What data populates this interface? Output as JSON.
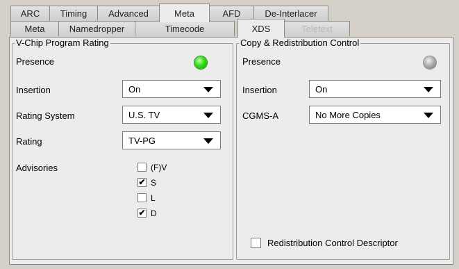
{
  "tabs_top": [
    {
      "label": "ARC",
      "active": false
    },
    {
      "label": "Timing",
      "active": false
    },
    {
      "label": "Advanced",
      "active": false
    },
    {
      "label": "Meta",
      "active": true
    },
    {
      "label": "AFD",
      "active": false
    },
    {
      "label": "De-Interlacer",
      "active": false
    }
  ],
  "tabs_sub": [
    {
      "label": "Meta",
      "active": false
    },
    {
      "label": "Namedropper",
      "active": false
    },
    {
      "label": "Timecode",
      "active": false
    },
    {
      "label": "XDS",
      "active": true
    },
    {
      "label": "Teletext",
      "active": false,
      "disabled": true
    }
  ],
  "vchip": {
    "title": "V-Chip Program Rating",
    "presence_label": "Presence",
    "presence_status": "green",
    "insertion_label": "Insertion",
    "insertion_value": "On",
    "rating_system_label": "Rating System",
    "rating_system_value": "U.S. TV",
    "rating_label": "Rating",
    "rating_value": "TV-PG",
    "advisories_label": "Advisories",
    "advisories": [
      {
        "label": "(F)V",
        "checked": false
      },
      {
        "label": "S",
        "checked": true
      },
      {
        "label": "L",
        "checked": false
      },
      {
        "label": "D",
        "checked": true
      }
    ]
  },
  "copy": {
    "title": "Copy & Redistribution Control",
    "presence_label": "Presence",
    "presence_status": "grey",
    "insertion_label": "Insertion",
    "insertion_value": "On",
    "cgms_label": "CGMS-A",
    "cgms_value": "No More Copies",
    "redistribution_label": "Redistribution Control Descriptor",
    "redistribution_checked": false
  },
  "check_mark": "✔"
}
